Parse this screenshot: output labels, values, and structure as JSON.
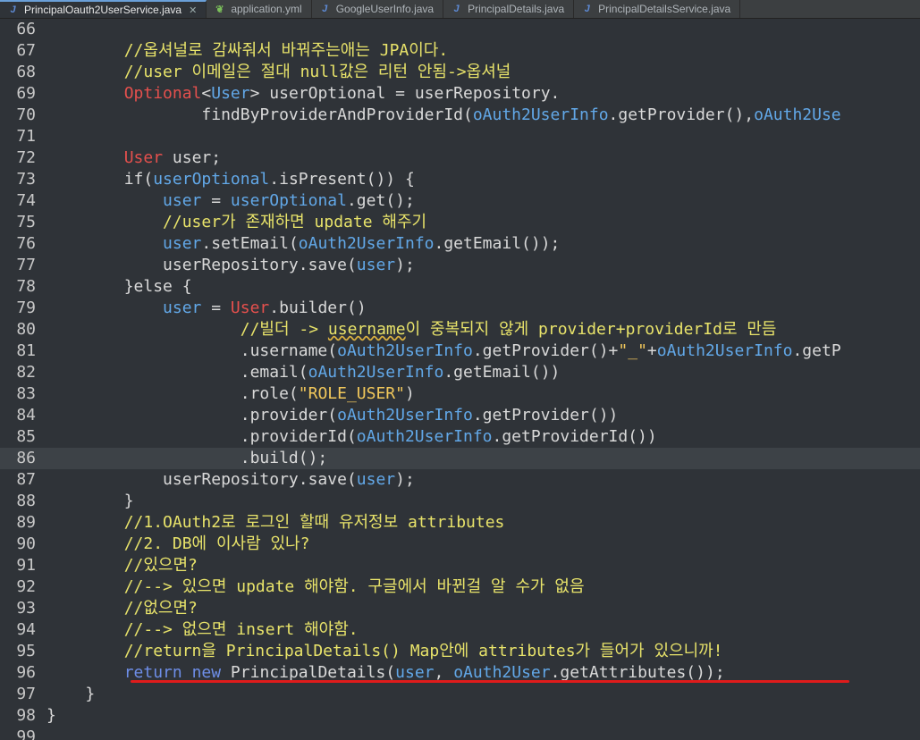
{
  "tabs": [
    {
      "label": "PrincipalOauth2UserService.java",
      "icon": "java-file-icon",
      "active": true,
      "closable": true
    },
    {
      "label": "application.yml",
      "icon": "yaml-file-icon"
    },
    {
      "label": "GoogleUserInfo.java",
      "icon": "java-file-icon"
    },
    {
      "label": "PrincipalDetails.java",
      "icon": "java-file-icon"
    },
    {
      "label": "PrincipalDetailsService.java",
      "icon": "java-file-icon"
    }
  ],
  "editor": {
    "highlighted_line": 86,
    "lines": [
      {
        "n": 66,
        "s": []
      },
      {
        "n": 67,
        "s": [
          [
            "        ",
            ""
          ],
          [
            "//옵셔널로 감싸줘서 바꿔주는애는 JPA이다.",
            "cmt"
          ]
        ]
      },
      {
        "n": 68,
        "s": [
          [
            "        ",
            ""
          ],
          [
            "//user 이메일은 절대 null값은 리턴 안됨->옵셔널",
            "cmt"
          ]
        ]
      },
      {
        "n": 69,
        "s": [
          [
            "        ",
            ""
          ],
          [
            "Optional",
            "type"
          ],
          [
            "<",
            ""
          ],
          [
            "User",
            "var"
          ],
          [
            "> userOptional = userRepository.",
            ""
          ]
        ]
      },
      {
        "n": 70,
        "s": [
          [
            "                findByProviderAndProviderId(",
            ""
          ],
          [
            "oAuth2UserInfo",
            "var"
          ],
          [
            ".getProvider(),",
            ""
          ],
          [
            "oAuth2Use",
            "var"
          ]
        ]
      },
      {
        "n": 71,
        "s": []
      },
      {
        "n": 72,
        "s": [
          [
            "        ",
            ""
          ],
          [
            "User",
            "type"
          ],
          [
            " user;",
            ""
          ]
        ]
      },
      {
        "n": 73,
        "s": [
          [
            "        if(",
            ""
          ],
          [
            "userOptional",
            "var"
          ],
          [
            ".isPresent()) {",
            ""
          ]
        ]
      },
      {
        "n": 74,
        "s": [
          [
            "            ",
            ""
          ],
          [
            "user",
            "var"
          ],
          [
            " = ",
            ""
          ],
          [
            "userOptional",
            "var"
          ],
          [
            ".get();",
            ""
          ]
        ]
      },
      {
        "n": 75,
        "s": [
          [
            "            ",
            ""
          ],
          [
            "//user가 존재하면 update 해주기",
            "cmt"
          ]
        ]
      },
      {
        "n": 76,
        "s": [
          [
            "            ",
            ""
          ],
          [
            "user",
            "var"
          ],
          [
            ".setEmail(",
            ""
          ],
          [
            "oAuth2UserInfo",
            "var"
          ],
          [
            ".getEmail());",
            ""
          ]
        ]
      },
      {
        "n": 77,
        "s": [
          [
            "            userRepository.save(",
            ""
          ],
          [
            "user",
            "var"
          ],
          [
            ");",
            ""
          ]
        ]
      },
      {
        "n": 78,
        "s": [
          [
            "        }else {",
            ""
          ]
        ]
      },
      {
        "n": 79,
        "s": [
          [
            "            ",
            ""
          ],
          [
            "user",
            "var"
          ],
          [
            " = ",
            ""
          ],
          [
            "User",
            "type"
          ],
          [
            ".builder()",
            ""
          ]
        ]
      },
      {
        "n": 80,
        "s": [
          [
            "                    ",
            ""
          ],
          [
            "//빌더 -> ",
            "cmt"
          ],
          [
            "username",
            "cmt squig"
          ],
          [
            "이 중복되지 않게 provider+providerId로 만듬",
            "cmt"
          ]
        ]
      },
      {
        "n": 81,
        "s": [
          [
            "                    .username(",
            ""
          ],
          [
            "oAuth2UserInfo",
            "var"
          ],
          [
            ".getProvider()+",
            ""
          ],
          [
            "\"_\"",
            "str"
          ],
          [
            "+",
            ""
          ],
          [
            "oAuth2UserInfo",
            "var"
          ],
          [
            ".getP",
            ""
          ]
        ]
      },
      {
        "n": 82,
        "s": [
          [
            "                    .email(",
            ""
          ],
          [
            "oAuth2UserInfo",
            "var"
          ],
          [
            ".getEmail())",
            ""
          ]
        ]
      },
      {
        "n": 83,
        "s": [
          [
            "                    .role(",
            ""
          ],
          [
            "\"ROLE_USER\"",
            "str"
          ],
          [
            ")",
            ""
          ]
        ]
      },
      {
        "n": 84,
        "s": [
          [
            "                    .provider(",
            ""
          ],
          [
            "oAuth2UserInfo",
            "var"
          ],
          [
            ".getProvider())",
            ""
          ]
        ]
      },
      {
        "n": 85,
        "s": [
          [
            "                    .providerId(",
            ""
          ],
          [
            "oAuth2UserInfo",
            "var"
          ],
          [
            ".getProviderId())",
            ""
          ]
        ]
      },
      {
        "n": 86,
        "s": [
          [
            "                    .build();",
            ""
          ]
        ]
      },
      {
        "n": 87,
        "s": [
          [
            "            userRepository.save(",
            ""
          ],
          [
            "user",
            "var"
          ],
          [
            ");",
            ""
          ]
        ]
      },
      {
        "n": 88,
        "s": [
          [
            "        }",
            ""
          ]
        ]
      },
      {
        "n": 89,
        "s": [
          [
            "        ",
            ""
          ],
          [
            "//1.OAuth2로 로그인 할때 유저정보 attributes",
            "cmt"
          ]
        ]
      },
      {
        "n": 90,
        "s": [
          [
            "        ",
            ""
          ],
          [
            "//2. DB에 이사람 있나?",
            "cmt"
          ]
        ]
      },
      {
        "n": 91,
        "s": [
          [
            "        ",
            ""
          ],
          [
            "//있으면?",
            "cmt"
          ]
        ]
      },
      {
        "n": 92,
        "s": [
          [
            "        ",
            ""
          ],
          [
            "//--> 있으면 update 해야함. 구글에서 바뀐걸 알 수가 없음",
            "cmt"
          ]
        ]
      },
      {
        "n": 93,
        "s": [
          [
            "        ",
            ""
          ],
          [
            "//없으면?",
            "cmt"
          ]
        ]
      },
      {
        "n": 94,
        "s": [
          [
            "        ",
            ""
          ],
          [
            "//--> 없으면 insert 해야함.",
            "cmt"
          ]
        ]
      },
      {
        "n": 95,
        "s": [
          [
            "        ",
            ""
          ],
          [
            "//return을 PrincipalDetails() Map안에 attributes가 들어가 있으니까!",
            "cmt"
          ]
        ]
      },
      {
        "n": 96,
        "s": [
          [
            "        ",
            ""
          ],
          [
            "return",
            "kw"
          ],
          [
            " ",
            ""
          ],
          [
            "new",
            "kw"
          ],
          [
            " PrincipalDetails(",
            ""
          ],
          [
            "user",
            "var"
          ],
          [
            ", ",
            ""
          ],
          [
            "oAuth2User",
            "var"
          ],
          [
            ".getAttributes());",
            ""
          ]
        ]
      },
      {
        "n": 97,
        "s": [
          [
            "    }",
            ""
          ]
        ]
      },
      {
        "n": 98,
        "s": [
          [
            "}",
            ""
          ]
        ]
      },
      {
        "n": 99,
        "s": []
      }
    ]
  },
  "annotation": {
    "underline_line": 96,
    "color": "#e01b1b"
  }
}
